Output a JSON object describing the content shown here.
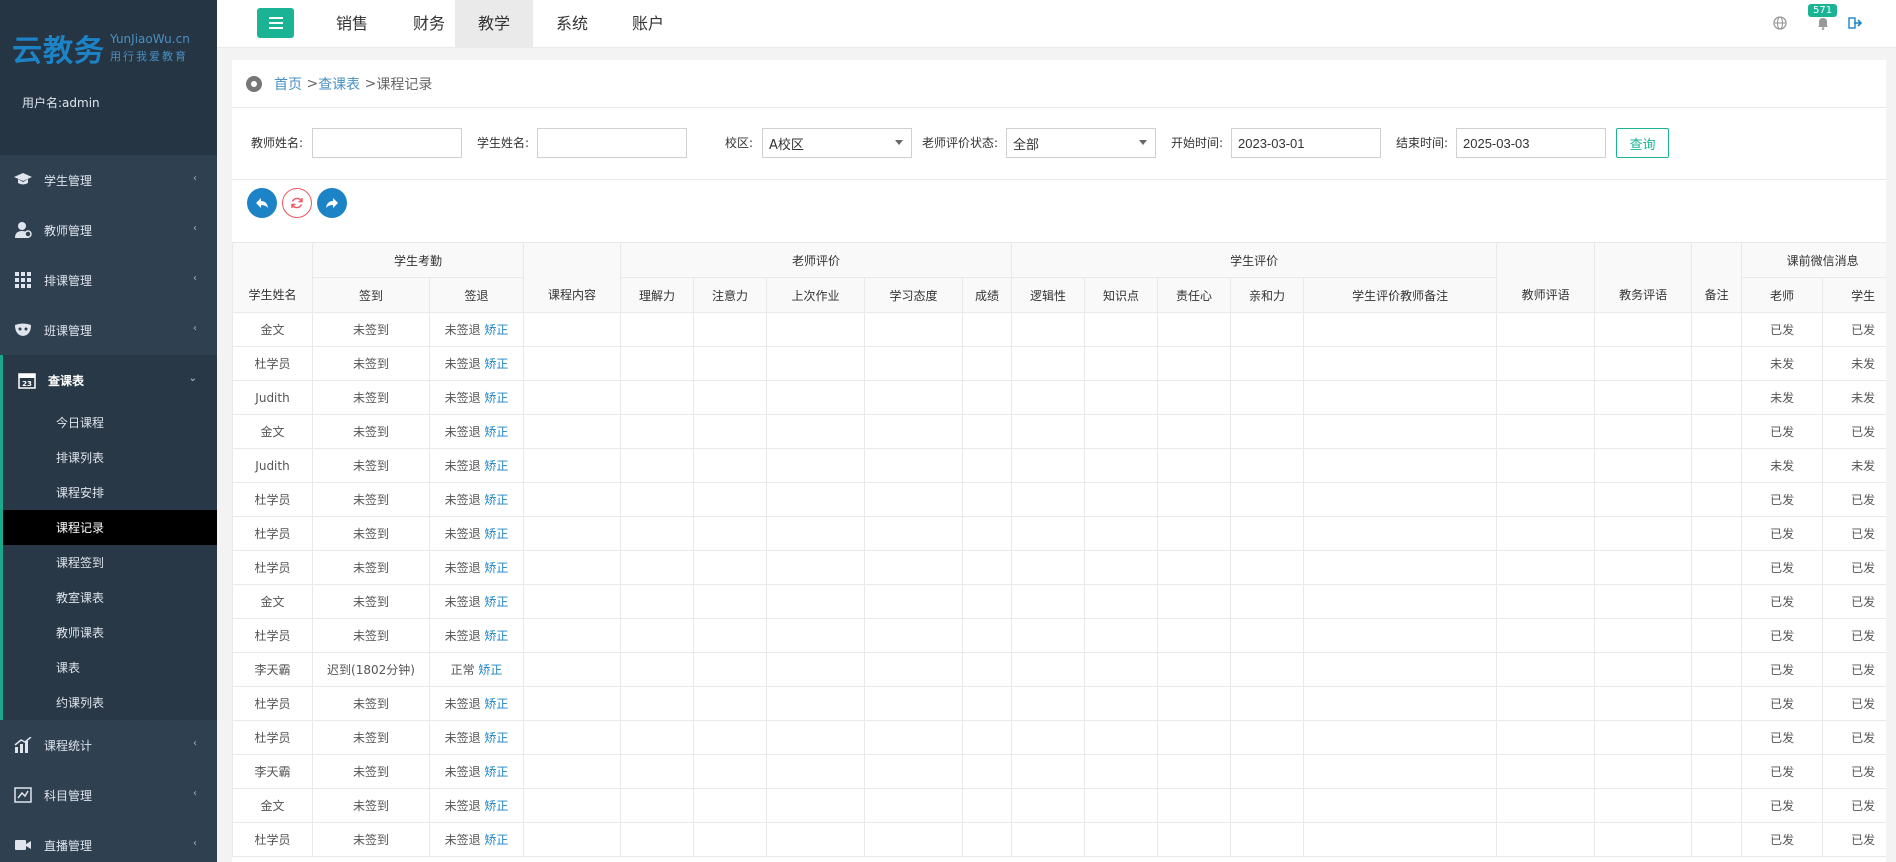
{
  "sidebar": {
    "logo_main": "云教务",
    "logo_domain": "YunJiaoWu.cn",
    "logo_tagline": "用行我爱教育",
    "username_label": "用户名:admin",
    "menu": [
      {
        "label": "学生管理",
        "icon": "graduation-cap-icon"
      },
      {
        "label": "教师管理",
        "icon": "teacher-icon"
      },
      {
        "label": "排课管理",
        "icon": "grid-icon"
      },
      {
        "label": "班课管理",
        "icon": "mask-icon"
      },
      {
        "label": "查课表",
        "icon": "calendar-icon"
      }
    ],
    "submenu": [
      "今日课程",
      "排课列表",
      "课程安排",
      "课程记录",
      "课程签到",
      "教室课表",
      "教师课表",
      "课表",
      "约课列表"
    ],
    "submenu_active": "课程记录",
    "menu_bottom": [
      {
        "label": "课程统计",
        "icon": "chart-icon"
      },
      {
        "label": "科目管理",
        "icon": "book-icon"
      },
      {
        "label": "直播管理",
        "icon": "video-icon"
      }
    ]
  },
  "topnav": {
    "tabs": [
      "销售",
      "财务",
      "教学",
      "系统",
      "账户"
    ],
    "active_tab": "教学",
    "notification_count": "571"
  },
  "breadcrumb": {
    "home": "首页",
    "parent": "查课表",
    "current": "课程记录"
  },
  "filters": {
    "teacher_name_label": "教师姓名:",
    "teacher_name_value": "",
    "student_name_label": "学生姓名:",
    "student_name_value": "",
    "campus_label": "校区:",
    "campus_value": "A校区",
    "eval_status_label": "老师评价状态:",
    "eval_status_value": "全部",
    "start_label": "开始时间:",
    "start_value": "2023-03-01",
    "end_label": "结束时间:",
    "end_value": "2025-03-03",
    "query_button": "查询"
  },
  "colors": {
    "sidebar_bg": "#2f4050",
    "accent": "#1ab394",
    "link": "#1c84c6",
    "tool_btn_blue": "#1c84c6",
    "tool_btn_red": "#ed5565"
  },
  "table": {
    "group_headers": {
      "attendance": "学生考勤",
      "teacher_eval": "老师评价",
      "student_eval": "学生评价",
      "wechat": "课前微信消息"
    },
    "headers": {
      "student_name": "学生姓名",
      "sign_in": "签到",
      "sign_out": "签退",
      "course_content": "课程内容",
      "comprehension": "理解力",
      "attention": "注意力",
      "last_homework": "上次作业",
      "attitude": "学习态度",
      "score": "成绩",
      "logic": "逻辑性",
      "knowledge": "知识点",
      "responsibility": "责任心",
      "affinity": "亲和力",
      "student_eval_note": "学生评价教师备注",
      "teacher_comment": "教师评语",
      "admin_comment": "教务评语",
      "remark": "备注",
      "wechat_teacher": "老师",
      "wechat_student": "学生"
    },
    "fix_link": "矫正",
    "rows": [
      {
        "name": "金文",
        "sign_in": "未签到",
        "sign_out": "未签退",
        "wx_teacher": "已发",
        "wx_student": "已发"
      },
      {
        "name": "杜学员",
        "sign_in": "未签到",
        "sign_out": "未签退",
        "wx_teacher": "未发",
        "wx_student": "未发"
      },
      {
        "name": "Judith",
        "sign_in": "未签到",
        "sign_out": "未签退",
        "wx_teacher": "未发",
        "wx_student": "未发"
      },
      {
        "name": "金文",
        "sign_in": "未签到",
        "sign_out": "未签退",
        "wx_teacher": "已发",
        "wx_student": "已发"
      },
      {
        "name": "Judith",
        "sign_in": "未签到",
        "sign_out": "未签退",
        "wx_teacher": "未发",
        "wx_student": "未发"
      },
      {
        "name": "杜学员",
        "sign_in": "未签到",
        "sign_out": "未签退",
        "wx_teacher": "已发",
        "wx_student": "已发"
      },
      {
        "name": "杜学员",
        "sign_in": "未签到",
        "sign_out": "未签退",
        "wx_teacher": "已发",
        "wx_student": "已发"
      },
      {
        "name": "杜学员",
        "sign_in": "未签到",
        "sign_out": "未签退",
        "wx_teacher": "已发",
        "wx_student": "已发"
      },
      {
        "name": "金文",
        "sign_in": "未签到",
        "sign_out": "未签退",
        "wx_teacher": "已发",
        "wx_student": "已发"
      },
      {
        "name": "杜学员",
        "sign_in": "未签到",
        "sign_out": "未签退",
        "wx_teacher": "已发",
        "wx_student": "已发"
      },
      {
        "name": "李天霸",
        "sign_in": "迟到(1802分钟)",
        "sign_out": "正常",
        "wx_teacher": "已发",
        "wx_student": "已发"
      },
      {
        "name": "杜学员",
        "sign_in": "未签到",
        "sign_out": "未签退",
        "wx_teacher": "已发",
        "wx_student": "已发"
      },
      {
        "name": "杜学员",
        "sign_in": "未签到",
        "sign_out": "未签退",
        "wx_teacher": "已发",
        "wx_student": "已发"
      },
      {
        "name": "李天霸",
        "sign_in": "未签到",
        "sign_out": "未签退",
        "wx_teacher": "已发",
        "wx_student": "已发"
      },
      {
        "name": "金文",
        "sign_in": "未签到",
        "sign_out": "未签退",
        "wx_teacher": "已发",
        "wx_student": "已发"
      },
      {
        "name": "杜学员",
        "sign_in": "未签到",
        "sign_out": "未签退",
        "wx_teacher": "已发",
        "wx_student": "已发"
      }
    ]
  }
}
